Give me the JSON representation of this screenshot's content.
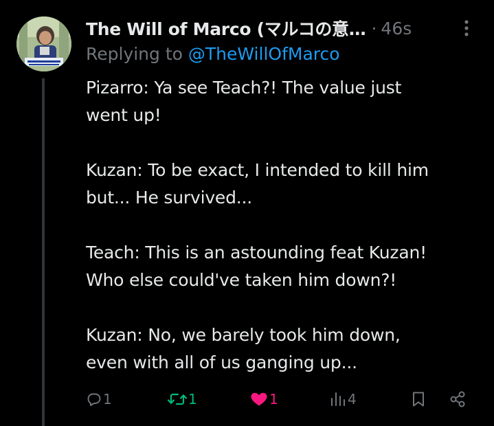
{
  "tweet": {
    "display_name": "The Will of Marco (マルコの意…",
    "separator": "·",
    "timestamp": "46s",
    "replying_prefix": "Replying to ",
    "replying_handle": "@TheWillOfMarco",
    "paragraphs": [
      [
        "Pizarro:  Ya see Teach?! The value just",
        "went up!"
      ],
      [
        "Kuzan: To be exact, I intended to kill him",
        "but... He survived..."
      ],
      [
        "Teach: This is an astounding feat Kuzan!",
        "Who else could've taken him down?!"
      ],
      [
        "Kuzan: No, we barely took him down,",
        "even with all of us ganging up..."
      ]
    ]
  },
  "actions": {
    "reply": {
      "icon": "reply-icon",
      "count": "1"
    },
    "retweet": {
      "icon": "retweet-icon",
      "count": "1",
      "color": "#00ba7c"
    },
    "like": {
      "icon": "heart-icon",
      "count": "1",
      "color": "#f91880"
    },
    "views": {
      "icon": "views-icon",
      "count": "4"
    },
    "bookmark": {
      "icon": "bookmark-icon"
    },
    "share": {
      "icon": "share-icon"
    }
  },
  "colors": {
    "background": "#000000",
    "text": "#e7e9ea",
    "muted": "#71767b",
    "link": "#1d9bf0"
  }
}
